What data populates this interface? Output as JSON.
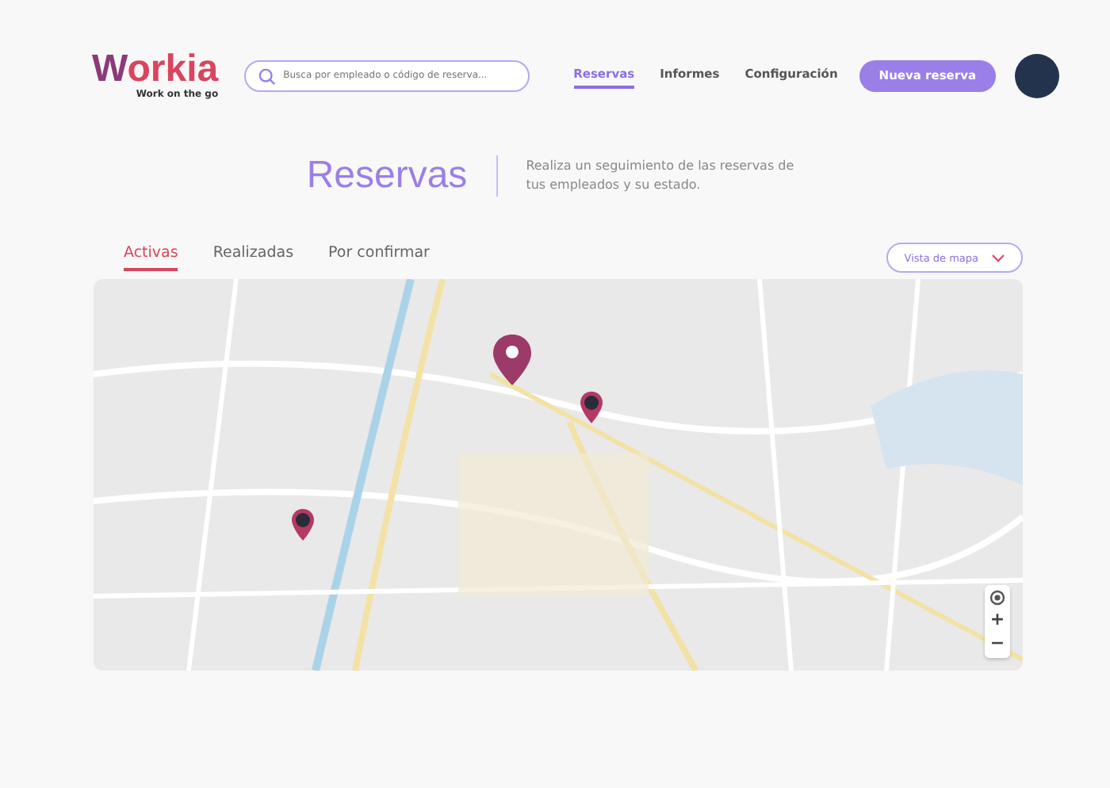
{
  "logo": {
    "name": "Workia",
    "tagline": "Work on the go"
  },
  "search": {
    "placeholder": "Busca por empleado o código de reserva..."
  },
  "nav": [
    {
      "label": "Reservas",
      "selected": true
    },
    {
      "label": "Informes",
      "selected": false
    },
    {
      "label": "Configuración",
      "selected": false
    }
  ],
  "new_button": "Nueva reserva",
  "header": {
    "title": "Reservas",
    "description": "Realiza un seguimiento de las reservas de tus empleados y su estado."
  },
  "tabs": [
    {
      "label": "Activas",
      "selected": true
    },
    {
      "label": "Realizadas",
      "selected": false
    },
    {
      "label": "Por confirmar",
      "selected": false
    }
  ],
  "view_select": "Vista de mapa",
  "map": {
    "pins": [
      {
        "kind": "location"
      },
      {
        "kind": "avatar"
      },
      {
        "kind": "avatar"
      }
    ],
    "zoom_in": "+",
    "zoom_out": "−"
  }
}
